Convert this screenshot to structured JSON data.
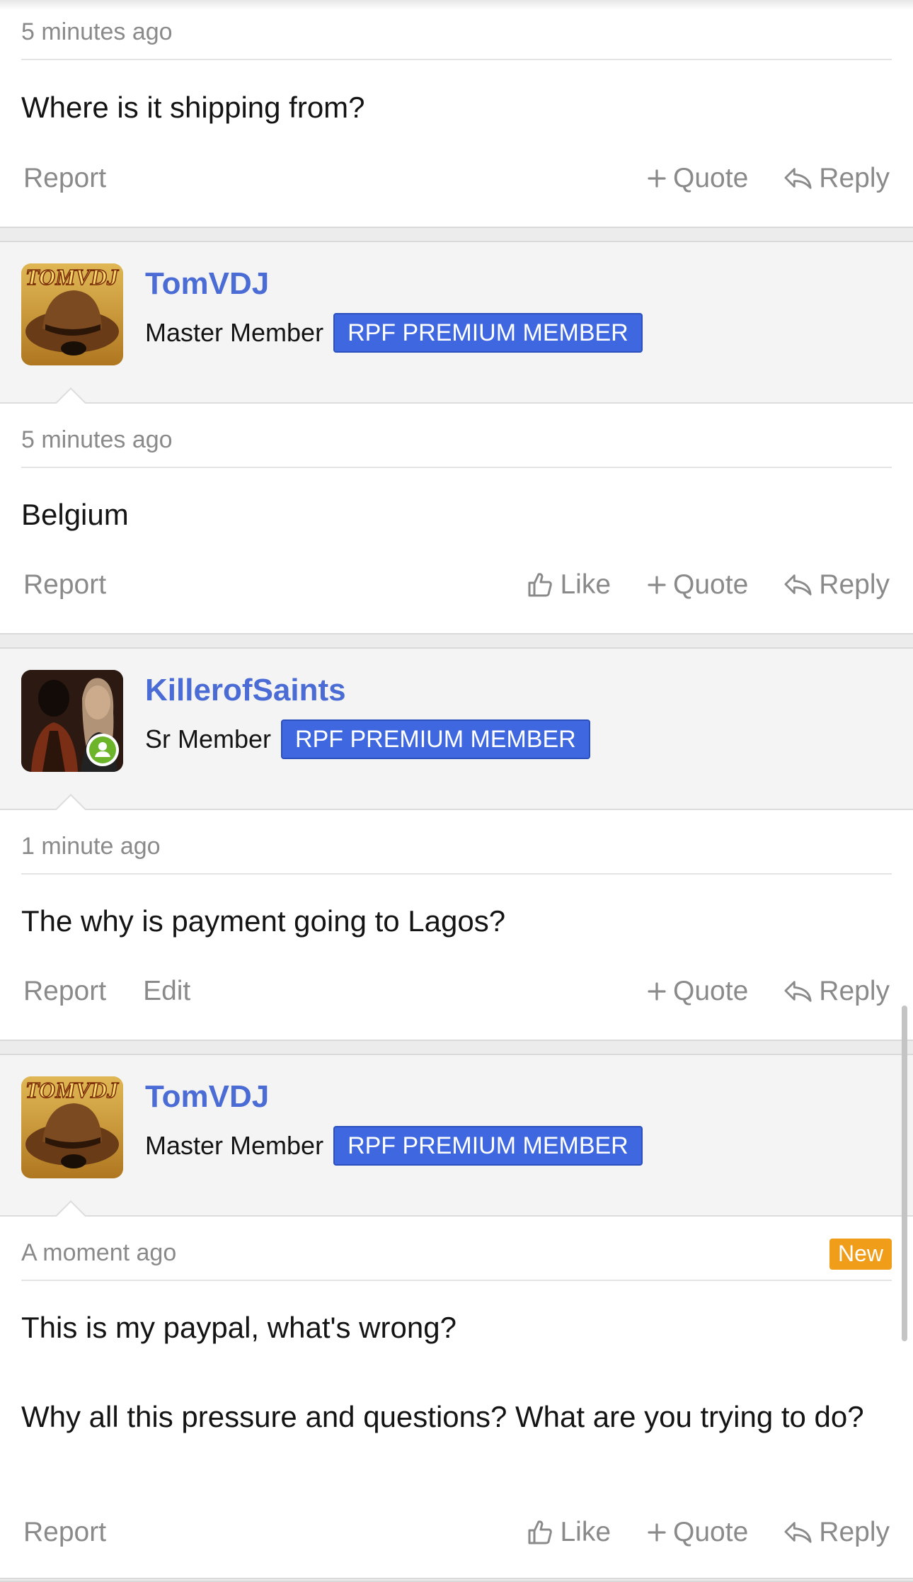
{
  "colors": {
    "accent": "#4a6cd4",
    "premium_badge": "#3f68e0",
    "new_badge": "#f09d1a",
    "online": "#6cb52a",
    "muted_text": "#8a8a8a"
  },
  "actions": {
    "report": "Report",
    "edit": "Edit",
    "like": "Like",
    "quote": "Quote",
    "reply": "Reply"
  },
  "badges": {
    "new": "New"
  },
  "posts": [
    {
      "time": "5 minutes ago",
      "body": [
        "Where is it shipping from?"
      ]
    },
    {
      "user": {
        "name": "TomVDJ",
        "rank": "Master Member",
        "badge": "RPF PREMIUM MEMBER",
        "avatar_icon": "tomvdj-fedora-avatar"
      },
      "time": "5 minutes ago",
      "body": [
        "Belgium"
      ]
    },
    {
      "user": {
        "name": "KillerofSaints",
        "rank": "Sr Member",
        "badge": "RPF PREMIUM MEMBER",
        "avatar_icon": "photo-avatar",
        "online": true
      },
      "time": "1 minute ago",
      "body": [
        "The why is payment going to Lagos?"
      ]
    },
    {
      "user": {
        "name": "TomVDJ",
        "rank": "Master Member",
        "badge": "RPF PREMIUM MEMBER",
        "avatar_icon": "tomvdj-fedora-avatar"
      },
      "time": "A moment ago",
      "is_new": true,
      "body": [
        "This is my paypal, what's wrong?",
        "Why all this pressure and questions? What are you trying to do?"
      ]
    }
  ]
}
